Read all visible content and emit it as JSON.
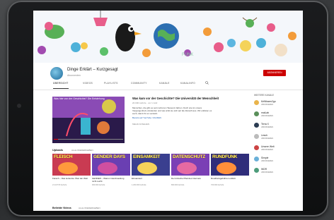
{
  "channel": {
    "name": "Dinge Erklärt – Kurzgesagt",
    "subs": "Abonnenten"
  },
  "subscribe_label": "ABONNIEREN",
  "tabs": [
    "ÜBERSICHT",
    "VIDEOS",
    "PLAYLISTS",
    "COMMUNITY",
    "KANÄLE",
    "KANALINFO"
  ],
  "player": {
    "title": "Was hier von der Geschichte? Die Entstehung"
  },
  "featured": {
    "title": "Was kam vor der Geschichte? Die Universität der Menschheit",
    "meta": "20.000 Aufrufe · vor 1 Jahr",
    "desc": "Menschen, die gibt es seit mehreren Tausend Jahren. Doch wie ist unsere Vergangenheit entstanden und wie wirkt sie sich auf die Zukunft aus. Wir erklären es euch, damit ihr es versteht.",
    "link": "Bereits auf YouTube: KAUFEN",
    "more": "MEHR ANSEHEN"
  },
  "side": {
    "heading": "WEITERE KANÄLE",
    "items": [
      {
        "name": "MrWissen2go",
        "sub": "ABONNIEREN",
        "color": "#e9b44c"
      },
      {
        "name": "maiLab",
        "sub": "ABONNIEREN",
        "color": "#5a8f5a"
      },
      {
        "name": "Terra X",
        "sub": "ABONNIEREN",
        "color": "#2b3c52"
      },
      {
        "name": "Lesch",
        "sub": "ABONNIEREN",
        "color": "#bbbbbb"
      },
      {
        "name": "Unsere Welt",
        "sub": "ABONNIEREN",
        "color": "#cc4444"
      },
      {
        "name": "Simple",
        "sub": "ABONNIEREN",
        "color": "#6ab0d8"
      },
      {
        "name": "WDR",
        "sub": "ABONNIEREN",
        "color": "#4d9c7a"
      }
    ]
  },
  "uploads": {
    "title": "Uploads",
    "play_all": "ALLE WIEDERGEBEN"
  },
  "videos": [
    {
      "thumb": "FLEISCH",
      "title": "Fleisch – Das leckerste Übel der Welt",
      "meta": "2.113.573 Aufrufe",
      "bg": "#c93b52",
      "blob": "#ff9a3c"
    },
    {
      "thumb": "GENDER DAYS",
      "title": "GENDER – Warum Gleichstellung nicht reicht",
      "meta": "900.000 Aufrufe",
      "bg": "#6a3fb2",
      "blob": "#d04fa0"
    },
    {
      "thumb": "EINSAMKEIT",
      "title": "Einsamkeit",
      "meta": "1.200.000 Aufrufe",
      "bg": "#3a3f8f",
      "blob": "#f6d35a"
    },
    {
      "thumb": "DATENSCHUTZ",
      "title": "Der kritische Pfad des Internets",
      "meta": "800.000 Aufrufe",
      "bg": "#7a3fb5",
      "blob": "#e66aa2"
    },
    {
      "thumb": "RUNDFUNK",
      "title": "Rundfunkgebühren erklärt",
      "meta": "700.000 Aufrufe",
      "bg": "#2f2d7a",
      "blob": "#ff8f3a"
    }
  ],
  "bottom": {
    "title": "Beliebte Videos",
    "play_all": "ALLE WIEDERGEBEN"
  }
}
